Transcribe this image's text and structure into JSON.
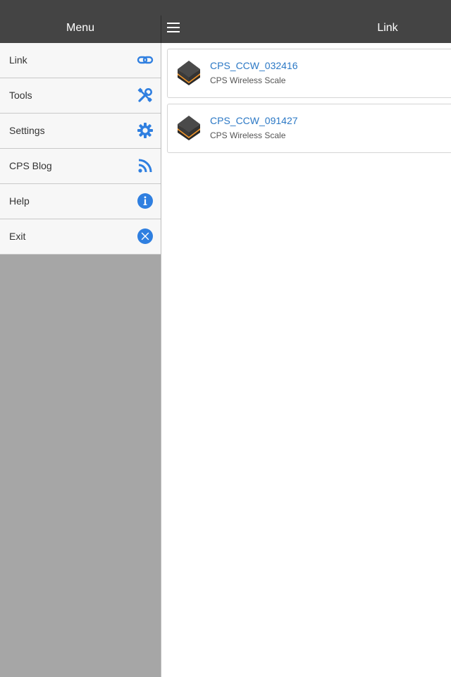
{
  "header": {
    "menu_title": "Menu",
    "page_title": "Link",
    "background": "#444444"
  },
  "sidebar": {
    "items": [
      {
        "label": "Link",
        "icon": "link-icon"
      },
      {
        "label": "Tools",
        "icon": "tools-icon"
      },
      {
        "label": "Settings",
        "icon": "gear-icon"
      },
      {
        "label": "CPS Blog",
        "icon": "rss-icon"
      },
      {
        "label": "Help",
        "icon": "info-icon"
      },
      {
        "label": "Exit",
        "icon": "close-icon"
      }
    ],
    "icon_color": "#2f7fe0"
  },
  "devices": [
    {
      "name": "CPS_CCW_032416",
      "type": "CPS Wireless Scale",
      "icon": "scale-device-icon"
    },
    {
      "name": "CPS_CCW_091427",
      "type": "CPS Wireless Scale",
      "icon": "scale-device-icon"
    }
  ],
  "colors": {
    "accent": "#2b78c5",
    "device_orange": "#f0952a",
    "device_dark": "#3a3a3a"
  }
}
